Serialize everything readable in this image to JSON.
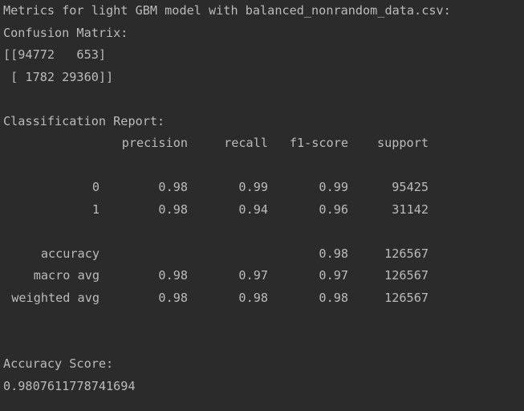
{
  "console": {
    "header": "Metrics for light GBM model with balanced_nonrandom_data.csv:",
    "confusion_label": "Confusion Matrix:",
    "matrix_row_1": "[[94772   653]",
    "matrix_row_2": " [ 1782 29360]]",
    "classification_label": "Classification Report:",
    "report": {
      "columns": [
        "precision",
        "recall",
        "f1-score",
        "support"
      ],
      "rows": [
        {
          "label": "0",
          "precision": "0.98",
          "recall": "0.99",
          "f1": "0.99",
          "support": "95425"
        },
        {
          "label": "1",
          "precision": "0.98",
          "recall": "0.94",
          "f1": "0.96",
          "support": "31142"
        }
      ],
      "summary": [
        {
          "label": "accuracy",
          "precision": "",
          "recall": "",
          "f1": "0.98",
          "support": "126567"
        },
        {
          "label": "macro avg",
          "precision": "0.98",
          "recall": "0.97",
          "f1": "0.97",
          "support": "126567"
        },
        {
          "label": "weighted avg",
          "precision": "0.98",
          "recall": "0.98",
          "f1": "0.98",
          "support": "126567"
        }
      ]
    },
    "accuracy_label": "Accuracy Score:",
    "accuracy_value": "0.9807611778741694"
  }
}
